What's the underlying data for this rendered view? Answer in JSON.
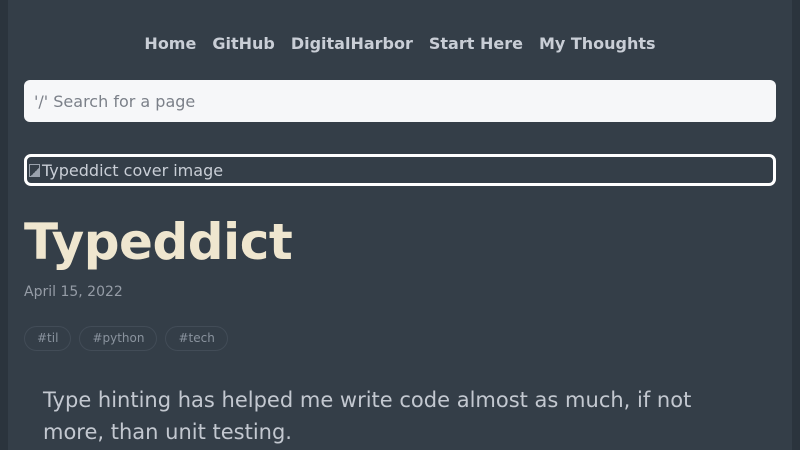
{
  "nav": {
    "items": [
      {
        "label": "Home"
      },
      {
        "label": "GitHub"
      },
      {
        "label": "DigitalHarbor"
      },
      {
        "label": "Start Here"
      },
      {
        "label": "My Thoughts"
      }
    ]
  },
  "search": {
    "placeholder": "'/' Search for a page",
    "value": ""
  },
  "post": {
    "cover_alt": "Typeddict cover image",
    "title": "Typeddict",
    "date": "April 15, 2022",
    "tags": [
      {
        "label": "#til"
      },
      {
        "label": "#python"
      },
      {
        "label": "#tech"
      }
    ],
    "intro": "Type hinting has helped me write code almost as much, if not more, than unit testing."
  },
  "colors": {
    "background": "#343e48",
    "title": "#efe6cf",
    "search_bg": "#f6f7f9"
  }
}
